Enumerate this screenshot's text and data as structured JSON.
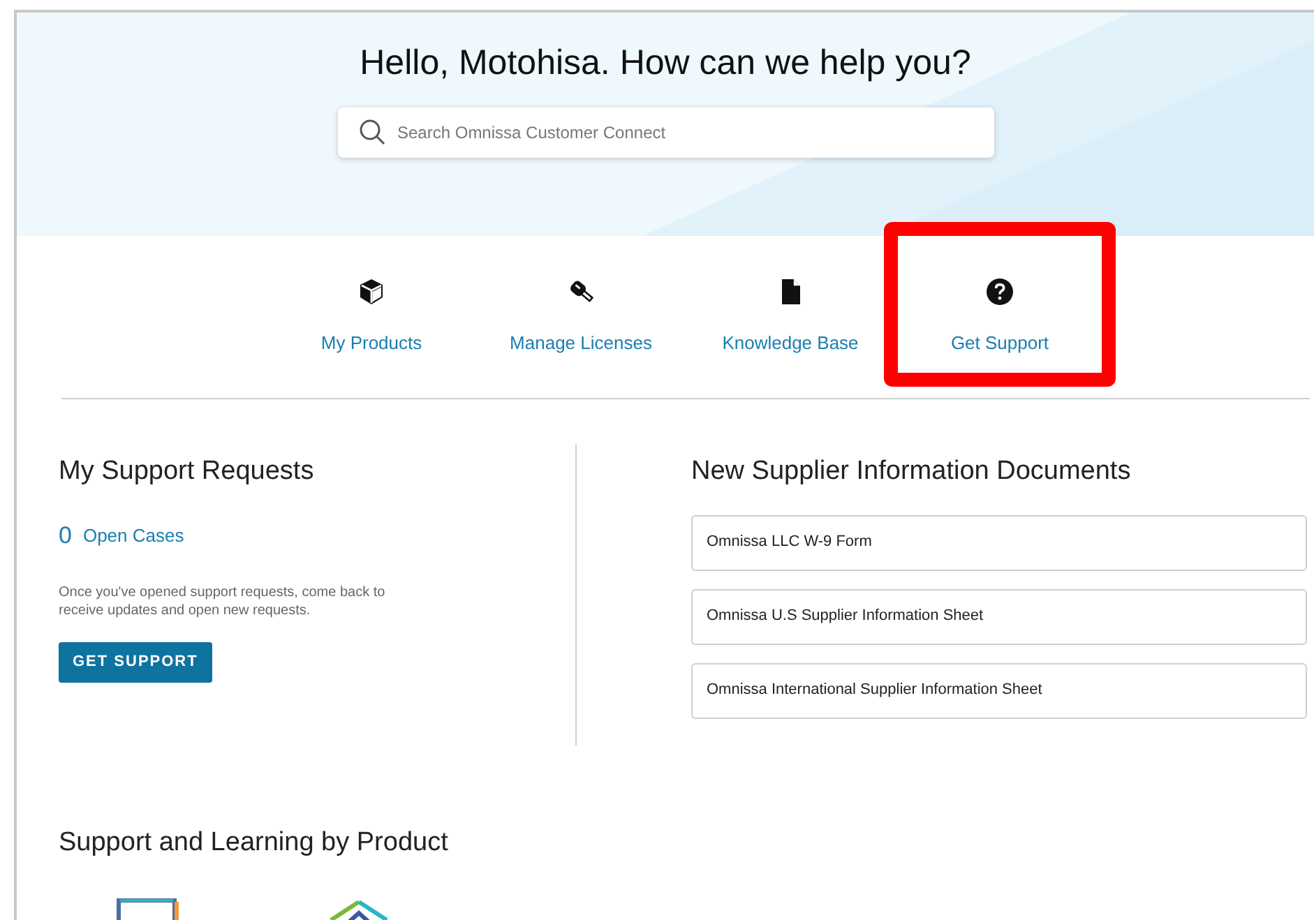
{
  "greeting": "Hello, Motohisa. How can we help you?",
  "search": {
    "placeholder": "Search Omnissa Customer Connect"
  },
  "quick_links": [
    {
      "kind": "box",
      "label": "My Products",
      "highlighted": false
    },
    {
      "kind": "key",
      "label": "Manage Licenses",
      "highlighted": false
    },
    {
      "kind": "document",
      "label": "Knowledge Base",
      "highlighted": false
    },
    {
      "kind": "help",
      "label": "Get Support",
      "highlighted": true
    }
  ],
  "support_requests": {
    "title": "My Support Requests",
    "count": "0",
    "count_label": "Open Cases",
    "message": "Once you've opened support requests, come back to receive updates and open new requests.",
    "button": "GET SUPPORT"
  },
  "supplier_documents": {
    "title": "New Supplier Information Documents",
    "items": [
      "Omnissa LLC W-9 Form",
      "Omnissa U.S Supplier Information Sheet",
      "Omnissa International Supplier Information Sheet"
    ]
  },
  "products_section": {
    "title": "Support and Learning by Product",
    "products": [
      {
        "kind": "monitor"
      },
      {
        "kind": "layers"
      }
    ]
  }
}
